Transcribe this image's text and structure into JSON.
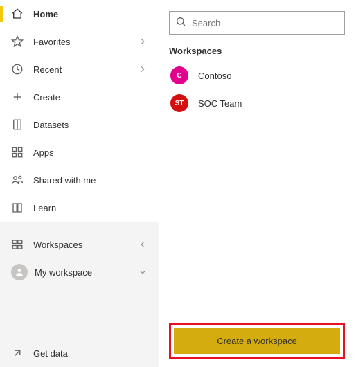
{
  "sidebar": {
    "items": [
      {
        "label": "Home",
        "icon": "home",
        "active": true,
        "chevron": false
      },
      {
        "label": "Favorites",
        "icon": "star",
        "active": false,
        "chevron": true
      },
      {
        "label": "Recent",
        "icon": "clock",
        "active": false,
        "chevron": true
      },
      {
        "label": "Create",
        "icon": "plus",
        "active": false,
        "chevron": false
      },
      {
        "label": "Datasets",
        "icon": "dataset",
        "active": false,
        "chevron": false
      },
      {
        "label": "Apps",
        "icon": "apps",
        "active": false,
        "chevron": false
      },
      {
        "label": "Shared with me",
        "icon": "shared",
        "active": false,
        "chevron": false
      },
      {
        "label": "Learn",
        "icon": "book",
        "active": false,
        "chevron": false
      }
    ],
    "workspaces_label": "Workspaces",
    "my_workspace_label": "My workspace",
    "get_data_label": "Get data"
  },
  "panel": {
    "search_placeholder": "Search",
    "section_title": "Workspaces",
    "workspaces": [
      {
        "initials": "C",
        "label": "Contoso",
        "color": "#e3008c"
      },
      {
        "initials": "ST",
        "label": "SOC Team",
        "color": "#d40f0f"
      }
    ],
    "create_button": "Create a workspace"
  }
}
